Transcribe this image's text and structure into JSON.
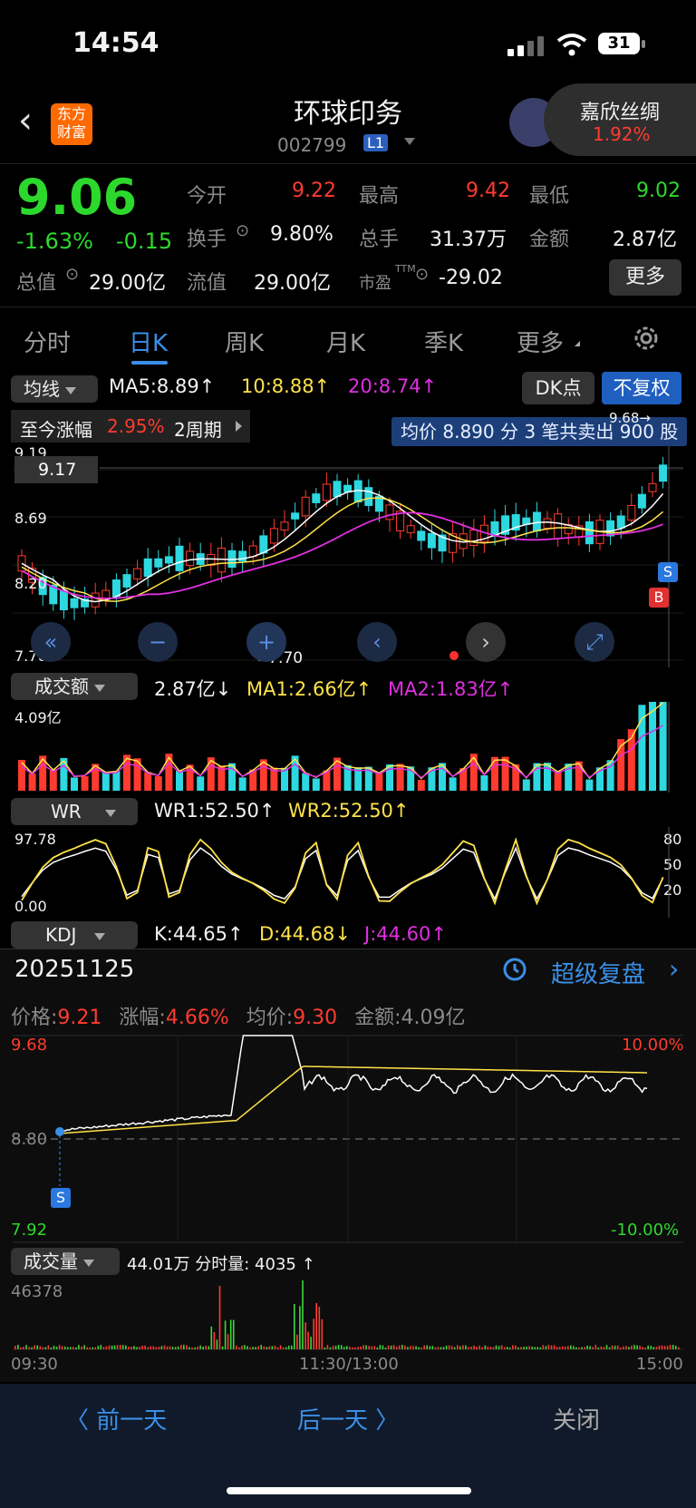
{
  "status": {
    "time": "14:54",
    "battery": "31"
  },
  "header": {
    "title": "环球印务",
    "code": "002799",
    "level": "L1",
    "logo_line1": "东方",
    "logo_line2": "财富",
    "peer_name": "嘉欣丝绸",
    "peer_change": "1.92%"
  },
  "quote": {
    "price": "9.06",
    "change_pct": "-1.63%",
    "change": "-0.15",
    "open_label": "今开",
    "open": "9.22",
    "high_label": "最高",
    "high": "9.42",
    "low_label": "最低",
    "low": "9.02",
    "turnover_label": "换手",
    "turnover": "9.80%",
    "volume_label": "总手",
    "volume": "31.37万",
    "amount_label": "金额",
    "amount": "2.87亿",
    "mktcap_label": "总值",
    "mktcap": "29.00亿",
    "float_label": "流值",
    "float": "29.00亿",
    "pe_label": "市盈",
    "pe_sup": "TTM",
    "pe": "-29.02",
    "more": "更多"
  },
  "tabs": [
    "分时",
    "日K",
    "周K",
    "月K",
    "季K",
    "更多"
  ],
  "kline": {
    "ma_selector": "均线",
    "ma5": "MA5:8.89↑",
    "ma10": "10:8.88↑",
    "ma20": "20:8.74↑",
    "dk": "DK点",
    "fq": "不复权",
    "since_label": "至今涨幅",
    "since_val": "2.95%",
    "since_period": "2周期",
    "tooltip": "均价 8.890 分 3 笔共卖出 900 股",
    "y_top": "9.19",
    "y_mid": "8.69",
    "y_low": "8.20",
    "y_bottom": "7.70",
    "cross_price": "9.17",
    "max_label": "9.68→",
    "min_label": "←7.70",
    "sell_marker": "S",
    "buy_marker": "B"
  },
  "volume_panel": {
    "selector": "成交额",
    "value": "2.87亿↓",
    "ma1": "MA1:2.66亿↑",
    "ma2": "MA2:1.83亿↑",
    "y_top": "4.09亿"
  },
  "wr_panel": {
    "selector": "WR",
    "wr1": "WR1:52.50↑",
    "wr2": "WR2:52.50↑",
    "y_top": "97.78",
    "y_bottom": "0.00",
    "r80": "80",
    "r50": "50",
    "r20": "20"
  },
  "kdj_panel": {
    "selector": "KDJ",
    "k": "K:44.65↑",
    "d": "D:44.68↓",
    "j": "J:44.60↑"
  },
  "review": {
    "date": "20251125",
    "super_label": "超级复盘"
  },
  "intraday": {
    "price_label": "价格:",
    "price": "9.21",
    "chg_label": "涨幅:",
    "chg": "4.66%",
    "avg_label": "均价:",
    "avg": "9.30",
    "amt_label": "金额:",
    "amt": "4.09亿",
    "y_top": "9.68",
    "y_mid": "8.80",
    "y_bottom": "7.92",
    "pct_top": "10.00%",
    "pct_bottom": "-10.00%",
    "sell_marker": "S",
    "vol_selector": "成交量",
    "vol_text": "44.01万  分时量: 4035 ↑",
    "vol_top": "46378",
    "t_start": "09:30",
    "t_mid": "11:30/13:00",
    "t_end": "15:00"
  },
  "bottom": {
    "prev": "〈 前一天",
    "next": "后一天 〉",
    "close": "关闭"
  },
  "colors": {
    "up": "#ff3b30",
    "down": "#2dd8e0",
    "ma5": "#ffffff",
    "ma10": "#ffe24a",
    "ma20": "#e030e0",
    "accent": "#3a8fe8"
  }
}
